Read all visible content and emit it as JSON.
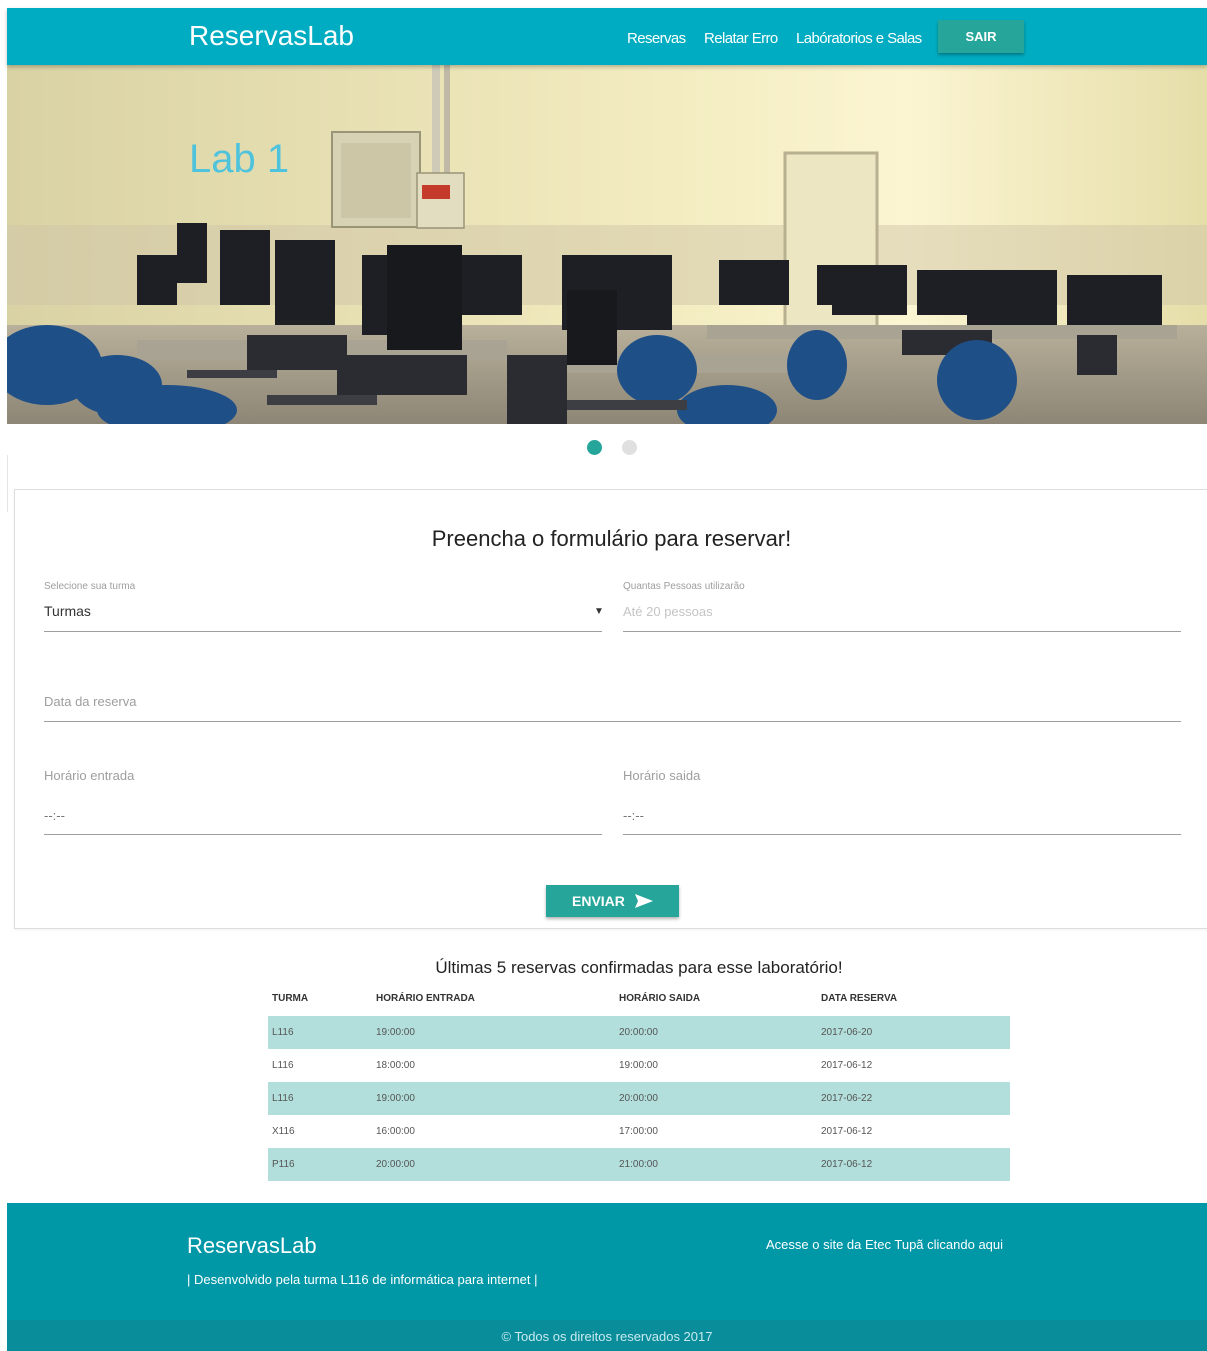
{
  "nav": {
    "brand": "ReservasLab",
    "links": [
      "Reservas",
      "Relatar Erro",
      "Labóratorios e Salas"
    ],
    "logout": "SAIR"
  },
  "slider": {
    "title": "Lab 1",
    "active_slide": 1,
    "slide_count": 2
  },
  "form": {
    "title": "Preencha o formulário para reservar!",
    "turma_label": "Selecione sua turma",
    "turma_value": "Turmas",
    "pessoas_label": "Quantas Pessoas utilizarão",
    "pessoas_placeholder": "Até 20 pessoas",
    "data_label": "Data da reserva",
    "entrada_label": "Horário entrada",
    "entrada_value": "--:--",
    "saida_label": "Horário saida",
    "saida_value": "--:--",
    "submit": "ENVIAR"
  },
  "table": {
    "title": "Últimas 5 reservas confirmadas para esse laboratório!",
    "headers": [
      "TURMA",
      "HORÁRIO ENTRADA",
      "HORÁRIO SAIDA",
      "DATA RESERVA"
    ],
    "rows": [
      [
        "L116",
        "19:00:00",
        "20:00:00",
        "2017-06-20"
      ],
      [
        "L116",
        "18:00:00",
        "19:00:00",
        "2017-06-12"
      ],
      [
        "L116",
        "19:00:00",
        "20:00:00",
        "2017-06-22"
      ],
      [
        "X116",
        "16:00:00",
        "17:00:00",
        "2017-06-12"
      ],
      [
        "P116",
        "20:00:00",
        "21:00:00",
        "2017-06-12"
      ]
    ]
  },
  "footer": {
    "brand": "ReservasLab",
    "dev": "| Desenvolvido pela turma L116 de informática para internet |",
    "link": "Acesse o site da Etec Tupã clicando aqui",
    "copyright": "© Todos os direitos reservados 2017"
  },
  "colors": {
    "primary": "#00acc1",
    "accent": "#26a69a",
    "row_highlight": "#b2dfdb",
    "footer": "#0097a7"
  }
}
